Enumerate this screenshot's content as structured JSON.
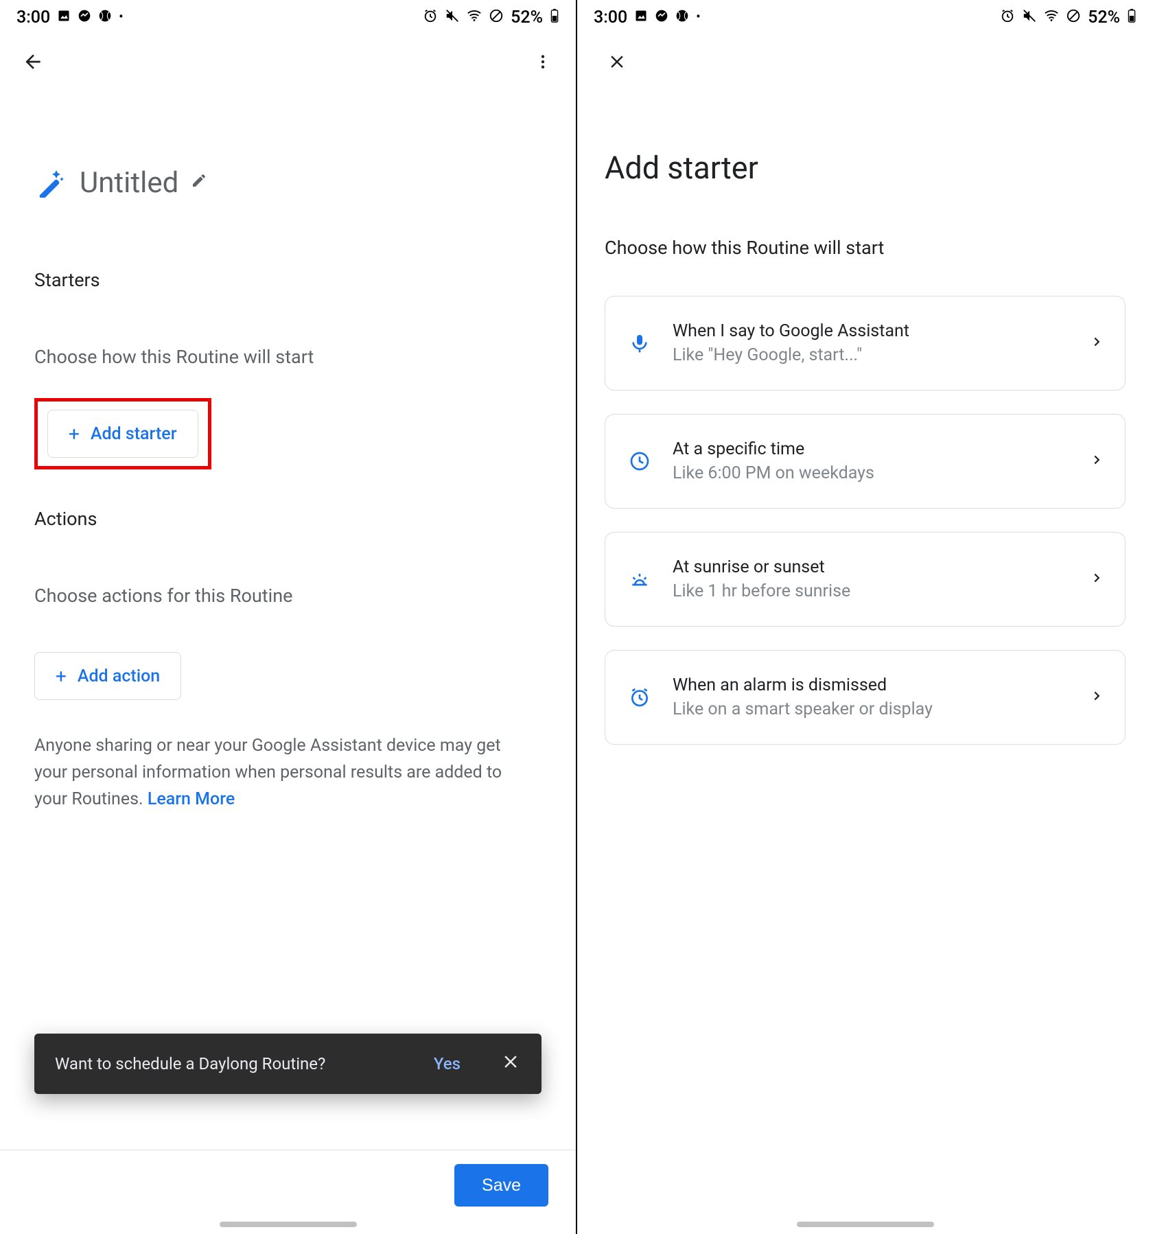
{
  "status_bar": {
    "time": "3:00",
    "battery_text": "52%"
  },
  "left": {
    "routine_title": "Untitled",
    "starters_heading": "Starters",
    "starters_sub": "Choose how this Routine will start",
    "add_starter_label": "Add starter",
    "actions_heading": "Actions",
    "actions_sub": "Choose actions for this Routine",
    "add_action_label": "Add action",
    "disclaimer_text": "Anyone sharing or near your Google Assistant device may get your personal information when personal results are added to your Routines. ",
    "learn_more": "Learn More",
    "snackbar_text": "Want to schedule a Daylong Routine?",
    "snackbar_yes": "Yes",
    "save_label": "Save"
  },
  "right": {
    "page_title": "Add starter",
    "page_sub": "Choose how this Routine will start",
    "options": [
      {
        "title": "When I say to Google Assistant",
        "sub": "Like \"Hey Google, start...\""
      },
      {
        "title": "At a specific time",
        "sub": "Like 6:00 PM on weekdays"
      },
      {
        "title": "At sunrise or sunset",
        "sub": "Like 1 hr before sunrise"
      },
      {
        "title": "When an alarm is dismissed",
        "sub": "Like on a smart speaker or display"
      }
    ]
  }
}
